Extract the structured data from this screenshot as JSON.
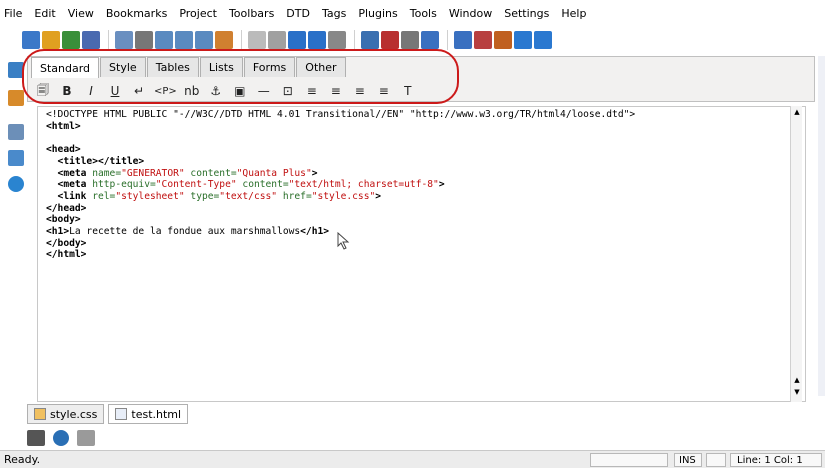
{
  "menubar": {
    "items": [
      "File",
      "Edit",
      "View",
      "Bookmarks",
      "Project",
      "Toolbars",
      "DTD",
      "Tags",
      "Plugins",
      "Tools",
      "Window",
      "Settings",
      "Help"
    ]
  },
  "main_toolbar": {
    "icons": [
      "new-document-icon",
      "open-folder-icon",
      "save-icon",
      "save-all-icon",
      "close-icon",
      "print-icon",
      "find-icon",
      "find-next-icon",
      "replace-icon",
      "cut-icon",
      "copy-icon",
      "paste-icon",
      "undo-icon",
      "redo-icon",
      "checkbox-icon",
      "preview-icon",
      "plugin-icon",
      "table-icon",
      "quick-start-icon",
      "doc-icon",
      "flag-icon",
      "color-icon",
      "back-icon",
      "forward-icon"
    ]
  },
  "panel": {
    "tabs": [
      "Standard",
      "Style",
      "Tables",
      "Lists",
      "Forms",
      "Other"
    ],
    "active_tab": "Standard",
    "icons": [
      {
        "name": "quickstart-icon",
        "glyph": "🗐"
      },
      {
        "name": "bold-icon",
        "glyph": "B"
      },
      {
        "name": "italic-icon",
        "glyph": "I"
      },
      {
        "name": "underline-icon",
        "glyph": "U"
      },
      {
        "name": "line-break-icon",
        "glyph": "↵"
      },
      {
        "name": "paragraph-icon",
        "glyph": "<P>"
      },
      {
        "name": "nbsp-icon",
        "glyph": "nb"
      },
      {
        "name": "anchor-icon",
        "glyph": "⚓"
      },
      {
        "name": "image-icon",
        "glyph": "▣"
      },
      {
        "name": "horizontal-rule-icon",
        "glyph": "—"
      },
      {
        "name": "comment-icon",
        "glyph": "⊡"
      },
      {
        "name": "align-left-icon",
        "glyph": "≡"
      },
      {
        "name": "align-center-icon",
        "glyph": "≡"
      },
      {
        "name": "align-right-icon",
        "glyph": "≡"
      },
      {
        "name": "align-justify-icon",
        "glyph": "≡"
      },
      {
        "name": "font-icon",
        "glyph": "T"
      }
    ]
  },
  "editor": {
    "lines": [
      {
        "kind": "doctype",
        "text": "<!DOCTYPE HTML PUBLIC \"-//W3C//DTD HTML 4.01 Transitional//EN\" \"http://www.w3.org/TR/html4/loose.dtd\">"
      },
      {
        "kind": "tag",
        "text": "<html>"
      },
      {
        "kind": "blank",
        "text": ""
      },
      {
        "kind": "tag",
        "text": "<head>"
      },
      {
        "kind": "tag",
        "text": "  <title></title>"
      },
      {
        "kind": "meta1",
        "pre": "  <meta ",
        "a1": "name=",
        "v1": "\"GENERATOR\"",
        "a2": " content=",
        "v2": "\"Quanta Plus\"",
        "post": ">"
      },
      {
        "kind": "meta1",
        "pre": "  <meta ",
        "a1": "http-equiv=",
        "v1": "\"Content-Type\"",
        "a2": " content=",
        "v2": "\"text/html; charset=utf-8\"",
        "post": ">"
      },
      {
        "kind": "link",
        "pre": "  <link ",
        "a1": "rel=",
        "v1": "\"stylesheet\"",
        "a2": " type=",
        "v2": "\"text/css\"",
        "a3": " href=",
        "v3": "\"style.css\"",
        "post": ">"
      },
      {
        "kind": "tag",
        "text": "</head>"
      },
      {
        "kind": "tag",
        "text": "<body>"
      },
      {
        "kind": "h1",
        "open": "<h1>",
        "content": "La recette de la fondue aux marshmallows",
        "close": "</h1>"
      },
      {
        "kind": "tag",
        "text": "</body>"
      },
      {
        "kind": "tag",
        "text": "</html>"
      }
    ]
  },
  "document_tabs": [
    {
      "label": "style.css",
      "active": false
    },
    {
      "label": "test.html",
      "active": true
    }
  ],
  "statusbar": {
    "message": "Ready.",
    "mode": "INS",
    "position": "Line: 1 Col: 1"
  },
  "colors": {
    "highlight": "#cc1a1a",
    "attr": "#2a6f2a",
    "value": "#c01010"
  }
}
